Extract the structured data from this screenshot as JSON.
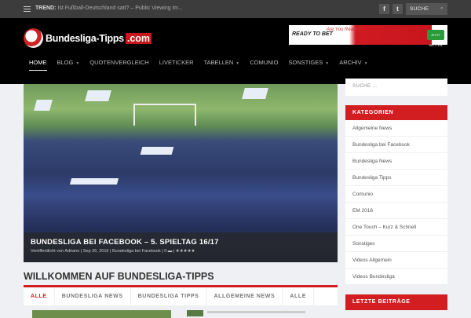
{
  "topbar": {
    "trend_label": "TREND:",
    "trend_text": "Ist Fußball-Deutschland satt? – Public Viewing im...",
    "facebook": "f",
    "twitter": "t",
    "search_placeholder": "SUCHE"
  },
  "header": {
    "logo_text": "Bundesliga-Tipps",
    "logo_suffix": ".com",
    "ad": {
      "brand": "READY TO BET",
      "slogan": "Are You Ready?",
      "button": "JETZT WETTEN"
    }
  },
  "nav": [
    {
      "label": "HOME",
      "active": true
    },
    {
      "label": "BLOG",
      "dropdown": true
    },
    {
      "label": "QUOTENVERGLEICH"
    },
    {
      "label": "LIVETICKER"
    },
    {
      "label": "TABELLEN",
      "dropdown": true
    },
    {
      "label": "COMUNIO"
    },
    {
      "label": "SONSTIGES",
      "dropdown": true
    },
    {
      "label": "ARCHIV",
      "dropdown": true
    }
  ],
  "hero": {
    "title": "BUNDESLIGA BEI FACEBOOK – 5. SPIELTAG 16/17",
    "meta": "Veröffentlicht von Adriano | Sep 26, 2016 | Bundesliga bei Facebook | 0 ▬ | ★★★★★"
  },
  "main": {
    "title": "WILLKOMMEN AUF BUNDESLIGA-TIPPS",
    "tabs": [
      "ALLE",
      "BUNDESLIGA NEWS",
      "BUNDESLIGA TIPPS",
      "ALLGEMEINE NEWS",
      "ALLE"
    ]
  },
  "sidebar": {
    "search_placeholder": "SUCHE ...",
    "categories_title": "KATEGORIEN",
    "categories": [
      "Allgemeine News",
      "Bundesliga bei Facebook",
      "Bundesliga News",
      "Bundesliga Tipps",
      "Comunio",
      "EM 2016",
      "One Touch – Kurz & Schnell",
      "Sonstiges",
      "Videos Allgemein",
      "Videos Bundesliga"
    ],
    "recent_title": "LETZTE BEITRÄGE"
  },
  "colors": {
    "accent": "#d21d21",
    "topbar": "#3c3c3c",
    "header": "#000000",
    "background": "#eef0f4"
  }
}
